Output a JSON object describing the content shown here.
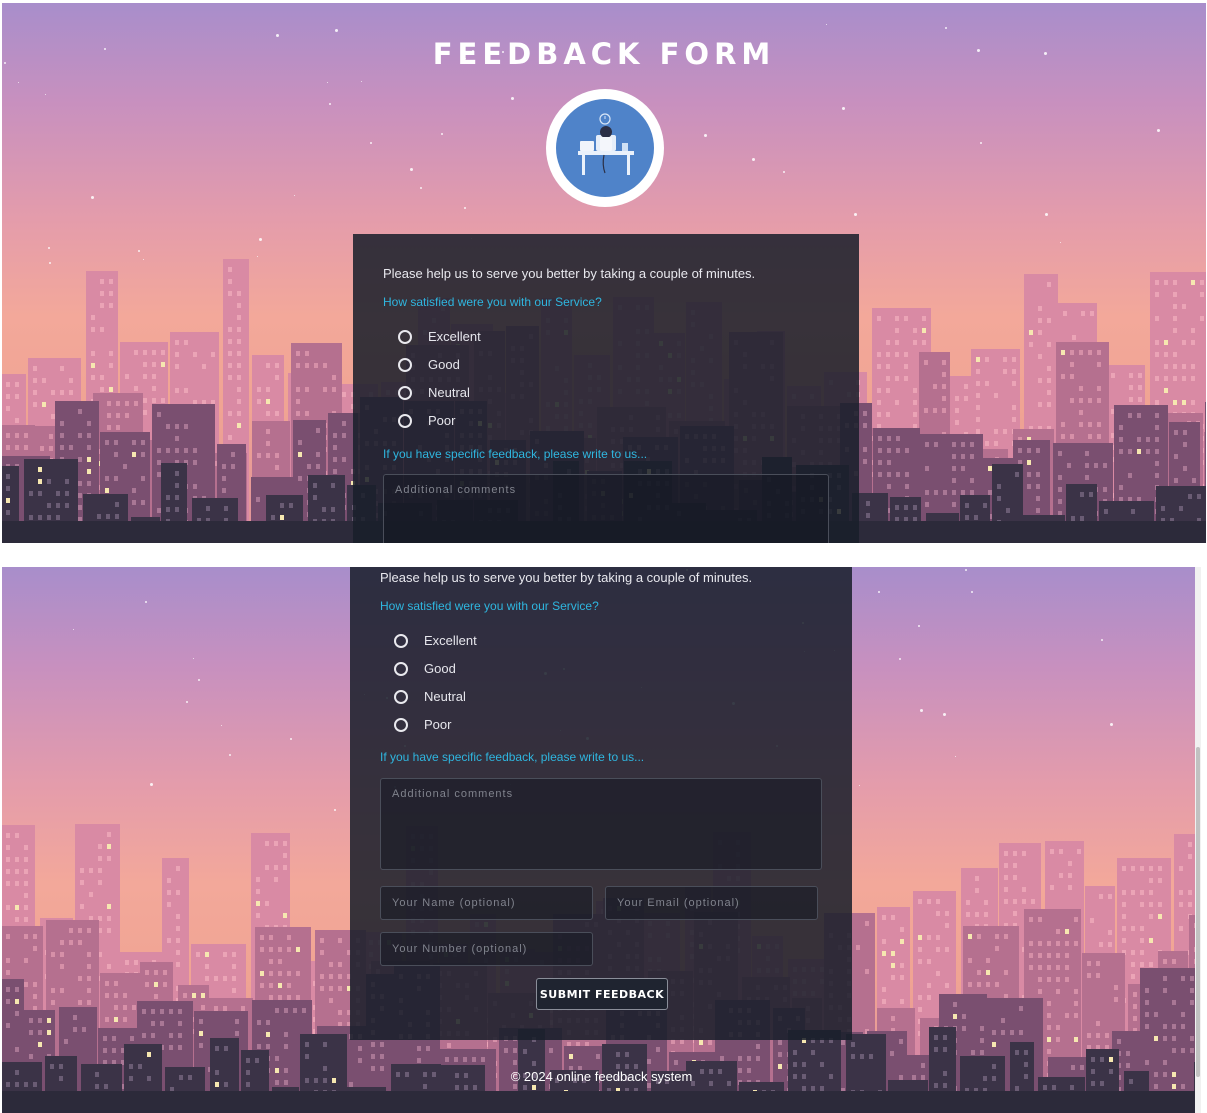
{
  "page": {
    "title": "FEEDBACK FORM",
    "footer": "© 2024 online feedback system"
  },
  "form": {
    "intro": "Please help us to serve you better by taking a couple of minutes.",
    "question_satisfaction": "How satisfied were you with our Service?",
    "options": [
      "Excellent",
      "Good",
      "Neutral",
      "Poor"
    ],
    "question_feedback": "If you have specific feedback, please write to us...",
    "comments_placeholder": "Additional comments",
    "name_placeholder": "Your Name (optional)",
    "email_placeholder": "Your Email (optional)",
    "number_placeholder": "Your Number (optional)",
    "submit_label": "SUBMIT FEEDBACK"
  },
  "colors": {
    "accent": "#2fb6df",
    "card": "#181e2a",
    "sky_top": "#a88ecb",
    "sky_bottom": "#f3a89a"
  },
  "icons": {
    "logo": "person-at-desk-illustration",
    "radio": "radio-circle"
  }
}
